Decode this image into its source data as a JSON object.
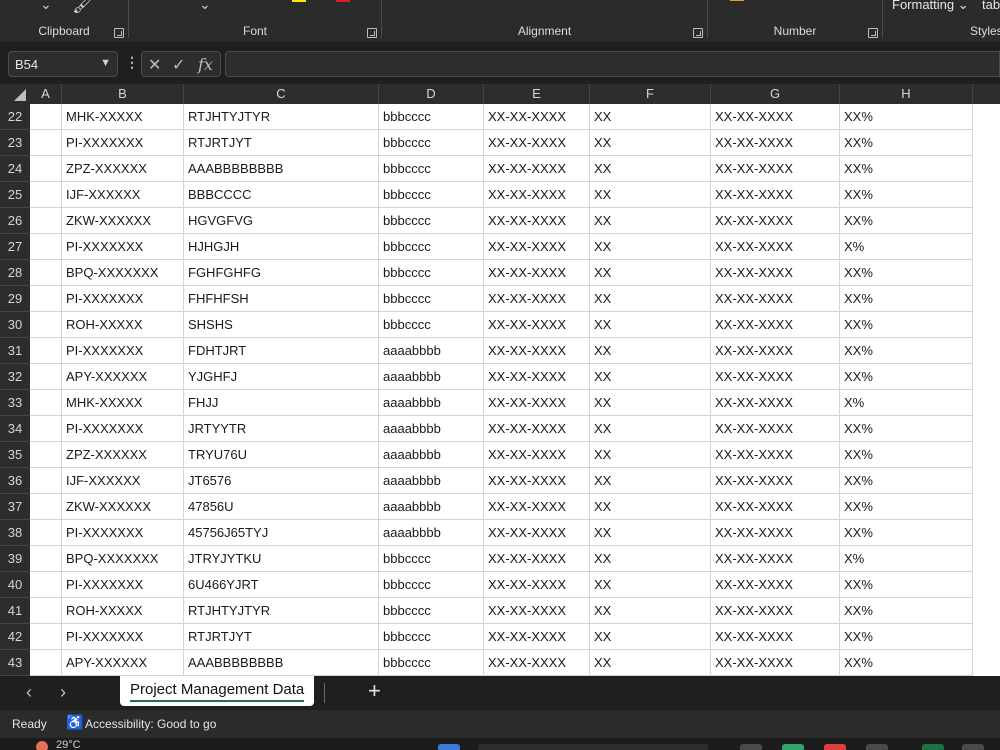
{
  "ribbon": {
    "groups": [
      {
        "label": "Clipboard"
      },
      {
        "label": "Font"
      },
      {
        "label": "Alignment"
      },
      {
        "label": "Number"
      }
    ],
    "formatting_label": "Formatting",
    "styles_label": "Styles",
    "table_cut": "tab",
    "colors": {
      "highlight": "#ffe600",
      "font_color": "#e02020"
    }
  },
  "formula_bar": {
    "name_box": "B54",
    "fx_label": "fx",
    "formula_value": ""
  },
  "columns": [
    "A",
    "B",
    "C",
    "D",
    "E",
    "F",
    "G",
    "H"
  ],
  "rows": [
    {
      "num": "22",
      "B": "MHK-XXXXX",
      "C": "RTJHTYJTYR",
      "D": "bbbcccc",
      "E": "XX-XX-XXXX",
      "F": "XX",
      "G": "XX-XX-XXXX",
      "H": "XX%"
    },
    {
      "num": "23",
      "B": "PI-XXXXXXX",
      "C": "RTJRTJYT",
      "D": "bbbcccc",
      "E": "XX-XX-XXXX",
      "F": "XX",
      "G": "XX-XX-XXXX",
      "H": "XX%"
    },
    {
      "num": "24",
      "B": "ZPZ-XXXXXX",
      "C": "AAABBBBBBBB",
      "D": "bbbcccc",
      "E": "XX-XX-XXXX",
      "F": "XX",
      "G": "XX-XX-XXXX",
      "H": "XX%"
    },
    {
      "num": "25",
      "B": "IJF-XXXXXX",
      "C": "BBBCCCC",
      "D": "bbbcccc",
      "E": "XX-XX-XXXX",
      "F": "XX",
      "G": "XX-XX-XXXX",
      "H": "XX%"
    },
    {
      "num": "26",
      "B": "ZKW-XXXXXX",
      "C": "HGVGFVG",
      "D": "bbbcccc",
      "E": "XX-XX-XXXX",
      "F": "XX",
      "G": "XX-XX-XXXX",
      "H": "XX%"
    },
    {
      "num": "27",
      "B": "PI-XXXXXXX",
      "C": "HJHGJH",
      "D": "bbbcccc",
      "E": "XX-XX-XXXX",
      "F": "XX",
      "G": "XX-XX-XXXX",
      "H": "X%"
    },
    {
      "num": "28",
      "B": "BPQ-XXXXXXX",
      "C": "FGHFGHFG",
      "D": "bbbcccc",
      "E": "XX-XX-XXXX",
      "F": "XX",
      "G": "XX-XX-XXXX",
      "H": "XX%"
    },
    {
      "num": "29",
      "B": "PI-XXXXXXX",
      "C": "FHFHFSH",
      "D": "bbbcccc",
      "E": "XX-XX-XXXX",
      "F": "XX",
      "G": "XX-XX-XXXX",
      "H": "XX%"
    },
    {
      "num": "30",
      "B": "ROH-XXXXX",
      "C": "SHSHS",
      "D": "bbbcccc",
      "E": "XX-XX-XXXX",
      "F": "XX",
      "G": "XX-XX-XXXX",
      "H": "XX%"
    },
    {
      "num": "31",
      "B": "PI-XXXXXXX",
      "C": "FDHTJRT",
      "D": "aaaabbbb",
      "E": "XX-XX-XXXX",
      "F": "XX",
      "G": "XX-XX-XXXX",
      "H": "XX%"
    },
    {
      "num": "32",
      "B": "APY-XXXXXX",
      "C": "YJGHFJ",
      "D": "aaaabbbb",
      "E": "XX-XX-XXXX",
      "F": "XX",
      "G": "XX-XX-XXXX",
      "H": "XX%"
    },
    {
      "num": "33",
      "B": "MHK-XXXXX",
      "C": "FHJJ",
      "D": "aaaabbbb",
      "E": "XX-XX-XXXX",
      "F": "XX",
      "G": "XX-XX-XXXX",
      "H": "X%"
    },
    {
      "num": "34",
      "B": "PI-XXXXXXX",
      "C": "JRTYYTR",
      "D": "aaaabbbb",
      "E": "XX-XX-XXXX",
      "F": "XX",
      "G": "XX-XX-XXXX",
      "H": "XX%"
    },
    {
      "num": "35",
      "B": "ZPZ-XXXXXX",
      "C": "TRYU76U",
      "D": "aaaabbbb",
      "E": "XX-XX-XXXX",
      "F": "XX",
      "G": "XX-XX-XXXX",
      "H": "XX%"
    },
    {
      "num": "36",
      "B": "IJF-XXXXXX",
      "C": "JT6576",
      "D": "aaaabbbb",
      "E": "XX-XX-XXXX",
      "F": "XX",
      "G": "XX-XX-XXXX",
      "H": "XX%"
    },
    {
      "num": "37",
      "B": "ZKW-XXXXXX",
      "C": "47856U",
      "D": "aaaabbbb",
      "E": "XX-XX-XXXX",
      "F": "XX",
      "G": "XX-XX-XXXX",
      "H": "XX%"
    },
    {
      "num": "38",
      "B": "PI-XXXXXXX",
      "C": "45756J65TYJ",
      "D": "aaaabbbb",
      "E": "XX-XX-XXXX",
      "F": "XX",
      "G": "XX-XX-XXXX",
      "H": "XX%"
    },
    {
      "num": "39",
      "B": "BPQ-XXXXXXX",
      "C": "JTRYJYTKU",
      "D": "bbbcccc",
      "E": "XX-XX-XXXX",
      "F": "XX",
      "G": "XX-XX-XXXX",
      "H": "X%"
    },
    {
      "num": "40",
      "B": "PI-XXXXXXX",
      "C": "6U466YJRT",
      "D": "bbbcccc",
      "E": "XX-XX-XXXX",
      "F": "XX",
      "G": "XX-XX-XXXX",
      "H": "XX%"
    },
    {
      "num": "41",
      "B": "ROH-XXXXX",
      "C": "RTJHTYJTYR",
      "D": "bbbcccc",
      "E": "XX-XX-XXXX",
      "F": "XX",
      "G": "XX-XX-XXXX",
      "H": "XX%"
    },
    {
      "num": "42",
      "B": "PI-XXXXXXX",
      "C": "RTJRTJYT",
      "D": "bbbcccc",
      "E": "XX-XX-XXXX",
      "F": "XX",
      "G": "XX-XX-XXXX",
      "H": "XX%"
    },
    {
      "num": "43",
      "B": "APY-XXXXXX",
      "C": "AAABBBBBBBB",
      "D": "bbbcccc",
      "E": "XX-XX-XXXX",
      "F": "XX",
      "G": "XX-XX-XXXX",
      "H": "XX%"
    }
  ],
  "sheet_tabs": [
    {
      "label": "Project Management Data",
      "active": true
    }
  ],
  "status": {
    "ready": "Ready",
    "accessibility": "Accessibility: Good to go"
  },
  "taskbar": {
    "weather": "29°C"
  }
}
